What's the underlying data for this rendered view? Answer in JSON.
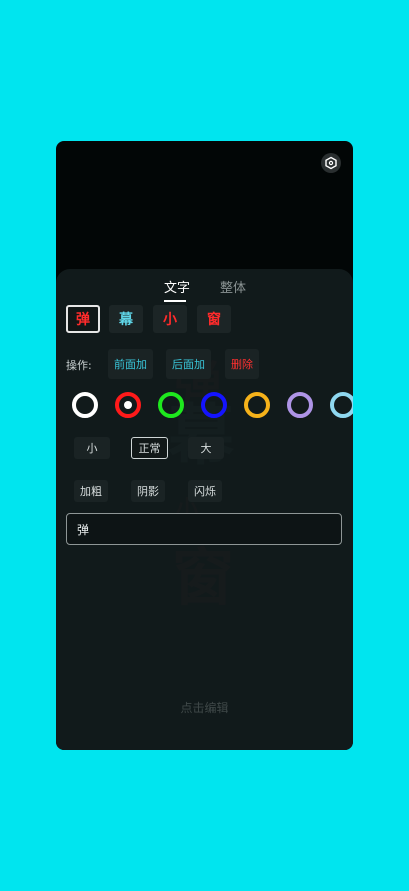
{
  "tabs": [
    {
      "label": "文字",
      "active": true
    },
    {
      "label": "整体",
      "active": false
    }
  ],
  "characters": [
    {
      "char": "弹",
      "color": "#ff2b2b",
      "selected": true
    },
    {
      "char": "幕",
      "color": "#5fd6e8",
      "selected": false
    },
    {
      "char": "小",
      "color": "#ff2b2b",
      "selected": false
    },
    {
      "char": "窗",
      "color": "#ff2b2b",
      "selected": false
    }
  ],
  "operations": {
    "label": "操作:",
    "buttons": [
      {
        "label": "前面加",
        "color": "#39c6da"
      },
      {
        "label": "后面加",
        "color": "#39c6da"
      },
      {
        "label": "删除",
        "color": "#ff3030"
      }
    ]
  },
  "colors": [
    {
      "name": "white",
      "hex": "#ffffff",
      "selected": false
    },
    {
      "name": "red",
      "hex": "#ff1a1a",
      "selected": true
    },
    {
      "name": "green",
      "hex": "#1ee81e",
      "selected": false
    },
    {
      "name": "blue",
      "hex": "#1414ff",
      "selected": false
    },
    {
      "name": "yellow",
      "hex": "#f6b21a",
      "selected": false
    },
    {
      "name": "lavender",
      "hex": "#ae94e6",
      "selected": false
    },
    {
      "name": "light-blue",
      "hex": "#8fd8f0",
      "selected": false
    }
  ],
  "sizes": [
    {
      "label": "小",
      "selected": false
    },
    {
      "label": "正常",
      "selected": true
    },
    {
      "label": "大",
      "selected": false
    }
  ],
  "styles": [
    "加粗",
    "阴影",
    "闪烁"
  ],
  "text_input": {
    "value": "弹"
  },
  "hint": "点击编辑",
  "background_text": [
    "弹",
    "幕",
    "小",
    "窗"
  ]
}
